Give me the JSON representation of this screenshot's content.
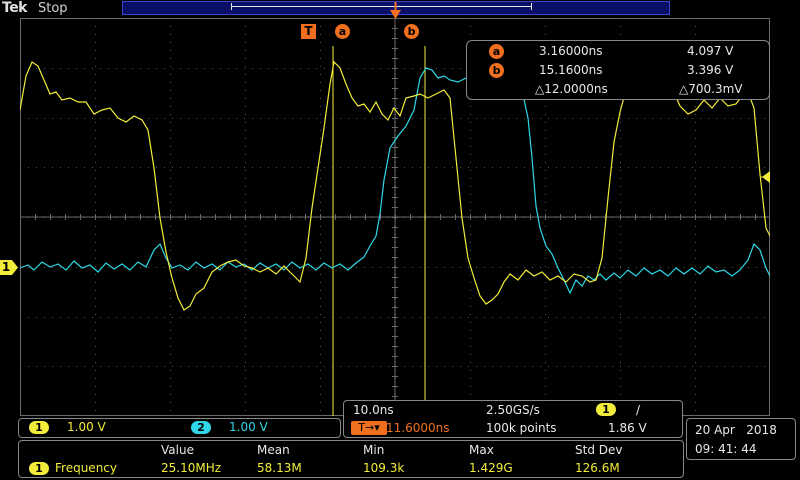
{
  "header": {
    "brand": "Tek",
    "run_state": "Stop"
  },
  "markers": {
    "trigger": "T",
    "cursor_a": "a",
    "cursor_b": "b",
    "ch1_ground": "1"
  },
  "cursor_readout": {
    "a": {
      "label": "a",
      "time": "3.16000ns",
      "voltage": "4.097 V"
    },
    "b": {
      "label": "b",
      "time": "15.1600ns",
      "voltage": "3.396 V"
    },
    "delta": {
      "time": "△12.0000ns",
      "voltage": "△700.3mV"
    }
  },
  "horizontal": {
    "time_per_div": "10.0ns",
    "sample_rate": "2.50GS/s",
    "trigger_channel": "1",
    "trigger_slope": "/",
    "trigger_pos_icon": "T→▾",
    "trigger_pos": "11.6000ns",
    "record_length": "100k points",
    "trigger_level": "1.86 V"
  },
  "channels": [
    {
      "num": "1",
      "scale": "1.00 V",
      "color": "#f2ec3a"
    },
    {
      "num": "2",
      "scale": "1.00 V",
      "color": "#2ed8e8"
    }
  ],
  "measurements": {
    "headers": [
      "Value",
      "Mean",
      "Min",
      "Max",
      "Std Dev"
    ],
    "row": {
      "channel": "1",
      "name": "Frequency",
      "value": "25.10MHz",
      "mean": "58.13M",
      "min": "109.3k",
      "max": "1.429G",
      "std_dev": "126.6M"
    }
  },
  "datetime": {
    "date": "20 Apr   2018",
    "time": "09: 41: 44"
  },
  "colors": {
    "ch1": "#f2ec3a",
    "ch2": "#2ed8e8",
    "cursor_marker": "#f07020",
    "grid": "#6a6a6a"
  }
}
